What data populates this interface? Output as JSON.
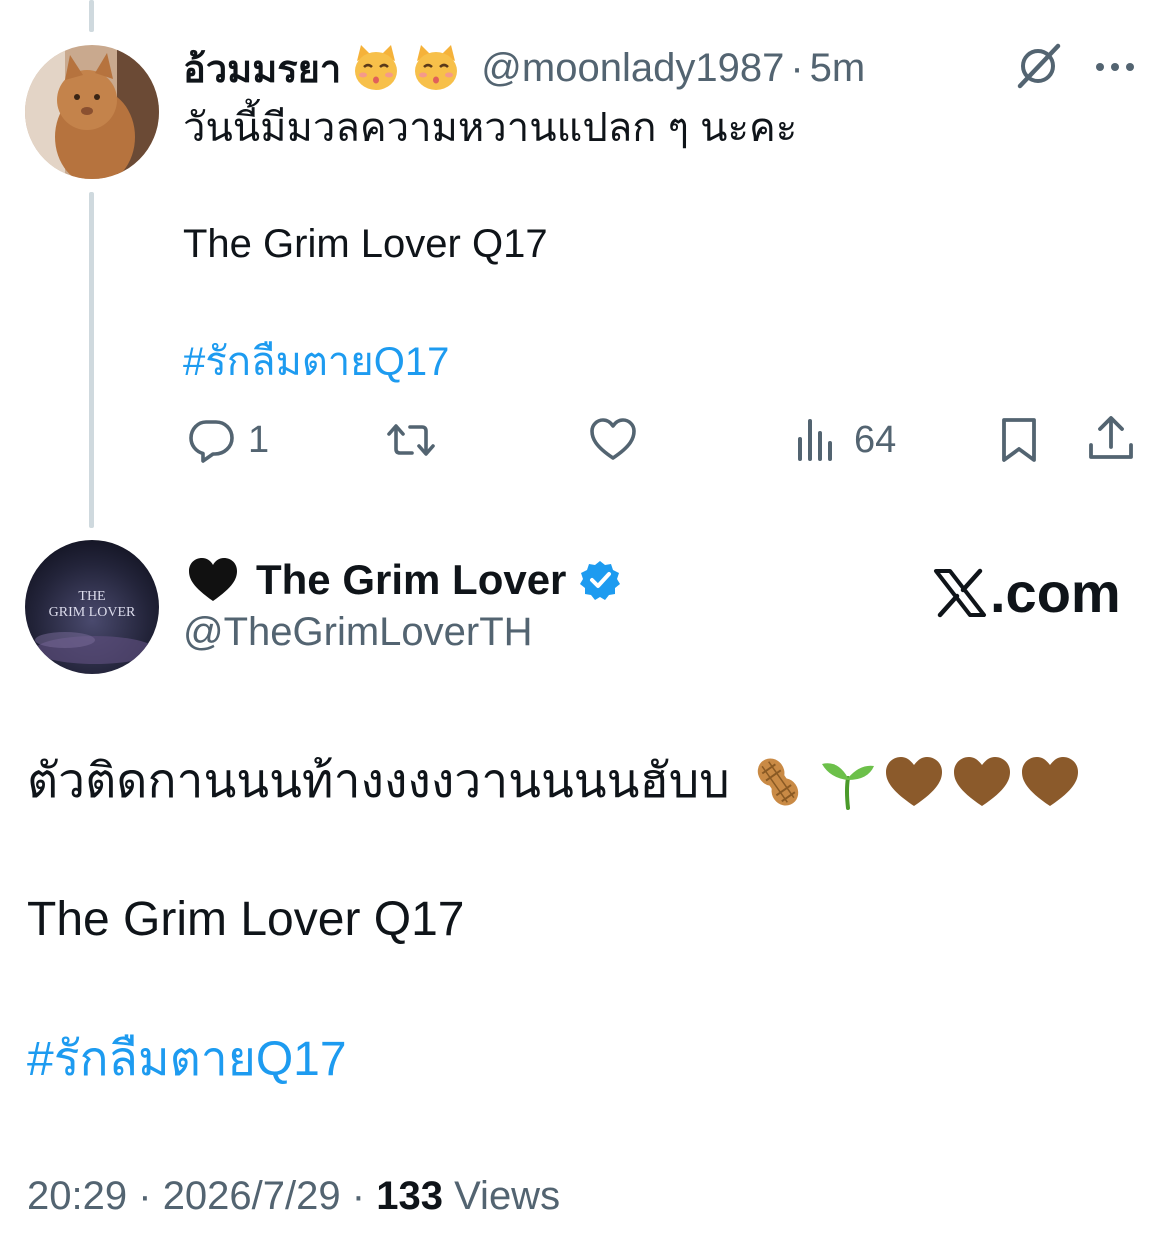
{
  "reply_tweet": {
    "display_name": "อ้วมมรยา",
    "name_emojis": [
      "kissing-cat-emoji",
      "kissing-cat-emoji"
    ],
    "handle": "@moonlady1987",
    "separator": "·",
    "time": "5m",
    "line1": "วันนี้มีมวลความหวานแปลก ๆ นะคะ",
    "line2": "The Grim Lover Q17",
    "hashtag": "#รักลืมตายQ17",
    "actions": {
      "reply_count": "1",
      "repost_count": "",
      "like_count": "",
      "views_count": "64"
    },
    "icons": [
      "grok-icon",
      "more-icon",
      "reply-icon",
      "repost-icon",
      "like-icon",
      "views-icon",
      "bookmark-icon",
      "share-icon"
    ]
  },
  "main_tweet": {
    "name_emoji": "black-heart-emoji",
    "display_name": "The Grim Lover",
    "verified": true,
    "handle": "@TheGrimLoverTH",
    "watermark": ".com",
    "line1": "ตัวติดกานนนท้างงงงวานนนนฮับบ",
    "line1_emojis": [
      "peanut-emoji",
      "seedling-emoji",
      "brown-heart-emoji",
      "brown-heart-emoji",
      "brown-heart-emoji"
    ],
    "line2": "The Grim Lover Q17",
    "hashtag": "#รักลืมตายQ17",
    "time": "20:29",
    "date": "2026/7/29",
    "separator": "·",
    "views_count": "133",
    "views_label": "Views"
  },
  "colors": {
    "text": "#0f1419",
    "secondary": "#536471",
    "link": "#1d9bf0",
    "thread_line": "#cfd9de",
    "brown_heart": "#8b5a2b"
  }
}
